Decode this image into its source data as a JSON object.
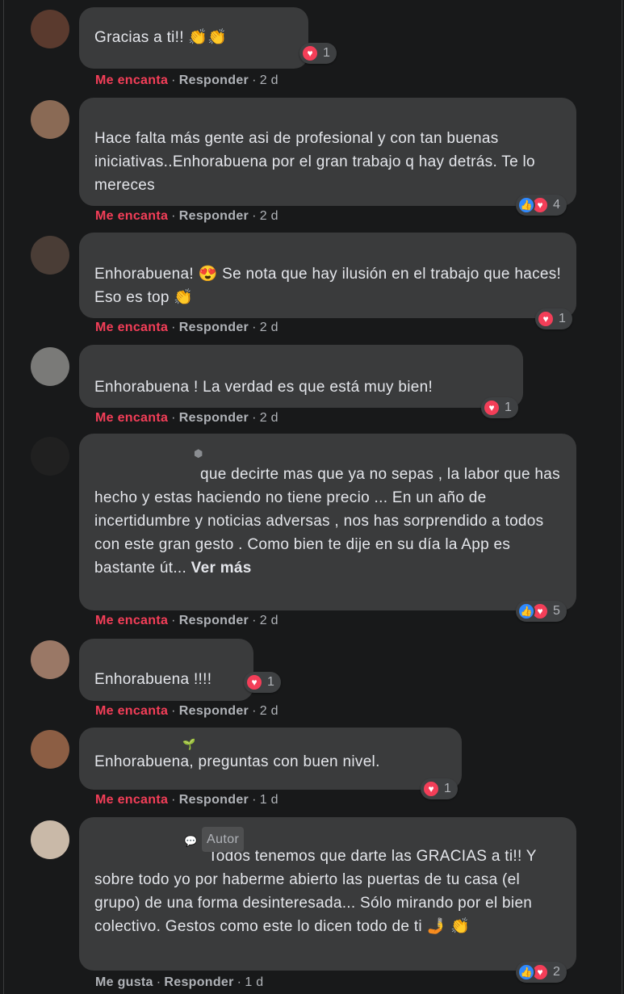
{
  "colors": {
    "background": "#18191a",
    "bubble": "#3a3b3c",
    "heart": "#f33e58",
    "like": "#2e89ff",
    "muted": "#b0b3b8"
  },
  "comments": [
    {
      "text": "Gracias a ti!! 👏👏",
      "reaction_count": "1",
      "reactions": [
        "heart-icon"
      ],
      "action_like": "Me encanta",
      "action_reply": "Responder",
      "time": "2 d"
    },
    {
      "text": "Hace falta más gente asi de profesional y con tan buenas iniciativas..Enhorabuena por el gran trabajo q hay detrás. Te lo mereces",
      "reaction_count": "4",
      "reactions": [
        "like-icon",
        "heart-icon"
      ],
      "action_like": "Me encanta",
      "action_reply": "Responder",
      "time": "2 d"
    },
    {
      "text": "Enhorabuena! 😍 Se nota que hay ilusión en el trabajo que haces! Eso es top 👏",
      "reaction_count": "1",
      "reactions": [
        "heart-icon"
      ],
      "action_like": "Me encanta",
      "action_reply": "Responder",
      "time": "2 d"
    },
    {
      "text": "Enhorabuena ! La verdad es que está muy bien!",
      "reaction_count": "1",
      "reactions": [
        "heart-icon"
      ],
      "action_like": "Me encanta",
      "action_reply": "Responder",
      "time": "2 d"
    },
    {
      "text": "que decirte mas que ya no sepas , la labor que has hecho y estas haciendo no tiene precio ... En un año de incertidumbre y noticias adversas , nos has sorprendido a todos con este gran gesto . Como bien te dije en su día la App es bastante út...",
      "see_more": "Ver más",
      "reaction_count": "5",
      "reactions": [
        "like-icon",
        "heart-icon"
      ],
      "action_like": "Me encanta",
      "action_reply": "Responder",
      "time": "2 d"
    },
    {
      "text": "Enhorabuena !!!!",
      "reaction_count": "1",
      "reactions": [
        "heart-icon"
      ],
      "action_like": "Me encanta",
      "action_reply": "Responder",
      "time": "2 d"
    },
    {
      "text": "Enhorabuena, preguntas con buen nivel.",
      "reaction_count": "1",
      "reactions": [
        "heart-icon"
      ],
      "action_like": "Me encanta",
      "action_reply": "Responder",
      "time": "1 d"
    },
    {
      "author_tag": "Autor",
      "text": "Todos tenemos que darte las GRACIAS a ti!! Y sobre todo yo por haberme abierto las puertas de tu casa (el grupo) de una forma desinteresada... Sólo mirando por el bien colectivo. Gestos como este lo dicen todo de ti 🤳 👏",
      "reaction_count": "2",
      "reactions": [
        "like-icon",
        "heart-icon"
      ],
      "action_like": "Me gusta",
      "action_reply": "Responder",
      "time": "1 d"
    }
  ]
}
